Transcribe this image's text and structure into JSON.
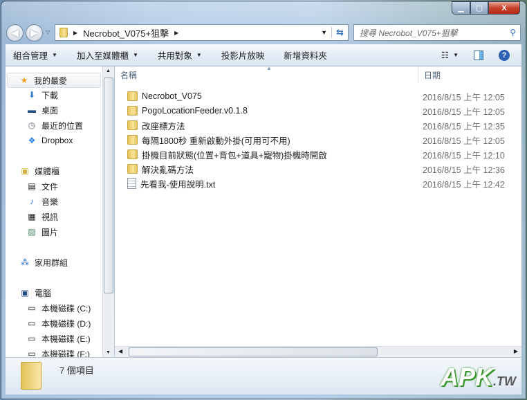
{
  "window": {
    "minimize": "▁",
    "maximize": "▢",
    "close": "X"
  },
  "address": {
    "path": "Necrobot_V075+狙擊",
    "search_placeholder": "搜尋 Necrobot_V075+狙擊"
  },
  "toolbar": {
    "organize": "組合管理",
    "add_to_library": "加入至媒體櫃",
    "share_with": "共用對象",
    "slideshow": "投影片放映",
    "new_folder": "新增資料夾"
  },
  "nav": {
    "favorites": {
      "label": "我的最愛",
      "items": [
        "下載",
        "桌面",
        "最近的位置",
        "Dropbox"
      ]
    },
    "libraries": {
      "label": "媒體櫃",
      "items": [
        "文件",
        "音樂",
        "視訊",
        "圖片"
      ]
    },
    "homegroup": "家用群組",
    "computer": {
      "label": "電腦",
      "items": [
        "本機磁碟 (C:)",
        "本機磁碟 (D:)",
        "本機磁碟 (E:)",
        "本機磁碟 (F:)"
      ]
    }
  },
  "columns": {
    "name": "名稱",
    "date": "日期"
  },
  "files": [
    {
      "name": "Necrobot_V075",
      "date": "2016/8/15 上午 12:05",
      "type": "folder"
    },
    {
      "name": "PogoLocationFeeder.v0.1.8",
      "date": "2016/8/15 上午 12:05",
      "type": "folder"
    },
    {
      "name": "改座標方法",
      "date": "2016/8/15 上午 12:35",
      "type": "folder"
    },
    {
      "name": "每隔1800秒 重新啟動外掛(可用可不用)",
      "date": "2016/8/15 上午 12:05",
      "type": "folder"
    },
    {
      "name": "掛機目前狀態(位置+背包+道具+寵物)掛機時開啟",
      "date": "2016/8/15 上午 12:10",
      "type": "folder"
    },
    {
      "name": "解決亂碼方法",
      "date": "2016/8/15 上午 12:36",
      "type": "folder"
    },
    {
      "name": "先看我-使用說明.txt",
      "date": "2016/8/15 上午 12:42",
      "type": "text"
    }
  ],
  "status": {
    "count": "7 個項目"
  },
  "watermark": {
    "main": "APK",
    "suffix": ".TW"
  }
}
